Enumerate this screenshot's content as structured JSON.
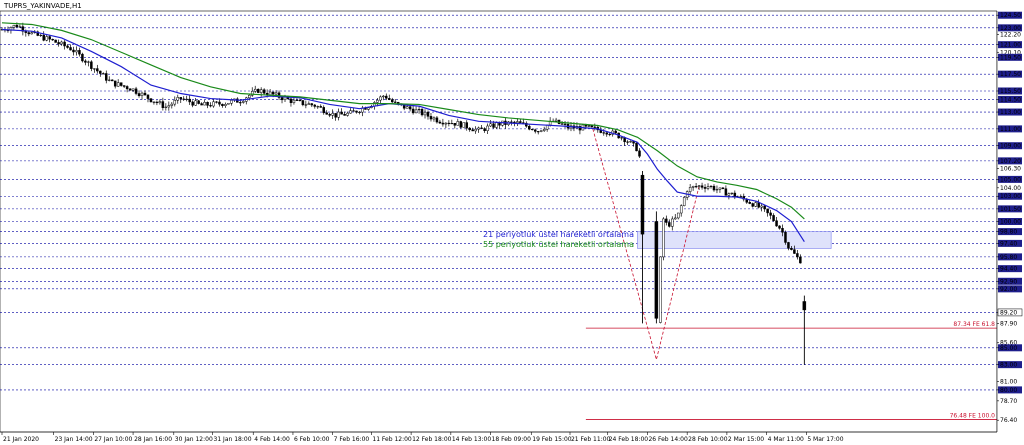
{
  "window": {
    "title": "TUPRS_YAKINVADE,H1"
  },
  "colors": {
    "background": "#ffffff",
    "grid": "#0000a0",
    "candles": "#000000",
    "ema21": "#1f1fd0",
    "ema55": "#1a8a1a",
    "zone_fill": "#dfe2fb",
    "zone_stroke": "#8a8ef0",
    "fib": "#c8102e",
    "label_bg": "#1e1e8c",
    "label_text": "#ffffff"
  },
  "chart_data": {
    "type": "candlestick",
    "title": "TUPRS_YAKINVADE,H1",
    "ylim": [
      75.0,
      125.0
    ],
    "y_tick_labels": [
      "124.50",
      "123.00",
      "122.20",
      "121.00",
      "120.10",
      "119.50",
      "117.50",
      "115.50",
      "114.50",
      "113.00",
      "111.00",
      "109.00",
      "107.20",
      "106.30",
      "105.00",
      "104.00",
      "103.00",
      "101.50",
      "100.00",
      "98.80",
      "97.40",
      "95.80",
      "94.40",
      "92.00",
      "92.90",
      "89.20",
      "87.90",
      "85.60",
      "85.00",
      "83.00",
      "81.00",
      "80.00",
      "78.70",
      "76.40"
    ],
    "y_tick_values": [
      124.5,
      123.0,
      122.2,
      121.0,
      120.1,
      119.5,
      117.5,
      115.5,
      114.5,
      113.0,
      111.0,
      109.0,
      107.2,
      106.3,
      105.0,
      104.0,
      103.0,
      101.5,
      100.0,
      98.8,
      97.4,
      95.8,
      94.4,
      92.0,
      92.9,
      89.2,
      87.9,
      85.6,
      85.0,
      83.0,
      81.0,
      80.0,
      78.7,
      76.4
    ],
    "highlighted_levels": [
      124.5,
      123.0,
      121.0,
      119.5,
      117.5,
      115.5,
      114.5,
      113.0,
      111.0,
      109.0,
      107.2,
      105.0,
      103.0,
      101.5,
      100.0,
      98.8,
      97.4,
      95.8,
      94.4,
      92.0,
      92.9,
      89.2,
      85.0,
      83.0,
      80.0
    ],
    "x_tick_labels": [
      "21 Jan 2020",
      "23 Jan 14:00",
      "27 Jan 10:00",
      "28 Jan 16:00",
      "30 Jan 12:00",
      "31 Jan 18:00",
      "4 Feb 14:00",
      "6 Feb 10:00",
      "7 Feb 16:00",
      "11 Feb 12:00",
      "12 Feb 18:00",
      "14 Feb 13:00",
      "18 Feb 09:00",
      "19 Feb 15:00",
      "21 Feb 11:00",
      "24 Feb 18:00",
      "26 Feb 14:00",
      "28 Feb 10:00",
      "2 Mar 15:00",
      "4 Mar 11:00",
      "5 Mar 17:00"
    ],
    "x_index_range": [
      0,
      1000
    ],
    "x_ticks_index": [
      0,
      52,
      92,
      132,
      173,
      212,
      253,
      293,
      333,
      372,
      412,
      452,
      492,
      533,
      572,
      610,
      650,
      690,
      730,
      770,
      810
    ],
    "price_path": [
      [
        0,
        122.8
      ],
      [
        15,
        123.3
      ],
      [
        30,
        122.3
      ],
      [
        50,
        121.5
      ],
      [
        70,
        120.5
      ],
      [
        90,
        118.5
      ],
      [
        110,
        116.5
      ],
      [
        130,
        115.8
      ],
      [
        150,
        114.5
      ],
      [
        165,
        113.6
      ],
      [
        180,
        114.6
      ],
      [
        200,
        113.8
      ],
      [
        220,
        114.0
      ],
      [
        240,
        114.4
      ],
      [
        258,
        115.6
      ],
      [
        275,
        115.0
      ],
      [
        295,
        114.2
      ],
      [
        315,
        113.8
      ],
      [
        335,
        112.6
      ],
      [
        350,
        112.8
      ],
      [
        370,
        113.8
      ],
      [
        385,
        115.0
      ],
      [
        395,
        114.0
      ],
      [
        420,
        113.0
      ],
      [
        440,
        112.0
      ],
      [
        460,
        111.6
      ],
      [
        480,
        110.8
      ],
      [
        500,
        111.6
      ],
      [
        520,
        111.7
      ],
      [
        540,
        110.8
      ],
      [
        555,
        111.9
      ],
      [
        570,
        111.2
      ],
      [
        590,
        111.1
      ],
      [
        610,
        110.7
      ],
      [
        625,
        110.0
      ],
      [
        640,
        108.6
      ],
      [
        648,
        105.0
      ],
      [
        655,
        100.5
      ],
      [
        660,
        88.0
      ],
      [
        665,
        100.5
      ],
      [
        670,
        99.5
      ],
      [
        680,
        100.5
      ],
      [
        690,
        103.8
      ],
      [
        700,
        104.2
      ],
      [
        712,
        104.2
      ],
      [
        725,
        103.6
      ],
      [
        740,
        103.0
      ],
      [
        755,
        102.2
      ],
      [
        765,
        101.5
      ],
      [
        775,
        100.5
      ],
      [
        785,
        99.0
      ],
      [
        792,
        97.0
      ],
      [
        800,
        95.8
      ],
      [
        806,
        95.2
      ]
    ],
    "spike_candles": [
      {
        "x": 645,
        "open": 105.5,
        "high": 106.0,
        "low": 87.9,
        "close": 98.5
      },
      {
        "x": 659,
        "open": 100.0,
        "high": 101.2,
        "low": 87.9,
        "close": 88.5
      },
      {
        "x": 808,
        "open": 90.5,
        "high": 91.2,
        "low": 83.0,
        "close": 89.5
      }
    ],
    "series": [
      {
        "name": "21 periyotluk üstel hareketli ortalama",
        "x": [
          0,
          30,
          60,
          90,
          120,
          150,
          180,
          210,
          240,
          270,
          300,
          330,
          360,
          390,
          420,
          450,
          480,
          510,
          540,
          570,
          600,
          620,
          640,
          650,
          660,
          670,
          680,
          700,
          720,
          740,
          760,
          780,
          795,
          808
        ],
        "values": [
          122.8,
          122.6,
          121.8,
          120.2,
          118.4,
          116.2,
          115.2,
          114.6,
          114.4,
          114.9,
          114.7,
          113.9,
          113.4,
          114.0,
          113.7,
          112.6,
          111.9,
          111.7,
          111.5,
          111.3,
          111.0,
          110.3,
          109.4,
          108.0,
          106.2,
          104.8,
          103.5,
          103.0,
          103.0,
          102.9,
          102.4,
          101.3,
          100.0,
          97.6
        ]
      },
      {
        "name": "55 periyotluk üstel hareketli ortalama",
        "x": [
          0,
          30,
          60,
          90,
          120,
          150,
          180,
          210,
          240,
          270,
          300,
          330,
          360,
          390,
          420,
          450,
          480,
          510,
          540,
          570,
          600,
          620,
          640,
          660,
          680,
          700,
          720,
          740,
          760,
          780,
          795,
          808
        ],
        "values": [
          123.6,
          123.4,
          122.7,
          121.6,
          120.1,
          118.6,
          117.1,
          116.0,
          115.2,
          115.0,
          114.8,
          114.4,
          114.0,
          114.0,
          113.9,
          113.3,
          112.7,
          112.3,
          112.0,
          111.7,
          111.4,
          110.9,
          110.0,
          108.4,
          106.6,
          105.3,
          104.7,
          104.3,
          103.8,
          102.7,
          101.7,
          100.3
        ]
      }
    ],
    "zone": {
      "y_top": 98.8,
      "y_bottom": 96.8,
      "x_start": 640,
      "x_end": 835
    },
    "fib_levels": [
      {
        "label": "87.34 FE 61.8",
        "value": 87.34,
        "x_start": 588
      },
      {
        "label": "76.48 FE 100.0",
        "value": 76.48,
        "x_start": 588
      }
    ],
    "fib_projection": {
      "x": [
        595,
        659,
        702
      ],
      "values": [
        111.0,
        83.6,
        104.2
      ]
    },
    "current_price_label": "89.20",
    "current_price_value": 89.2
  }
}
